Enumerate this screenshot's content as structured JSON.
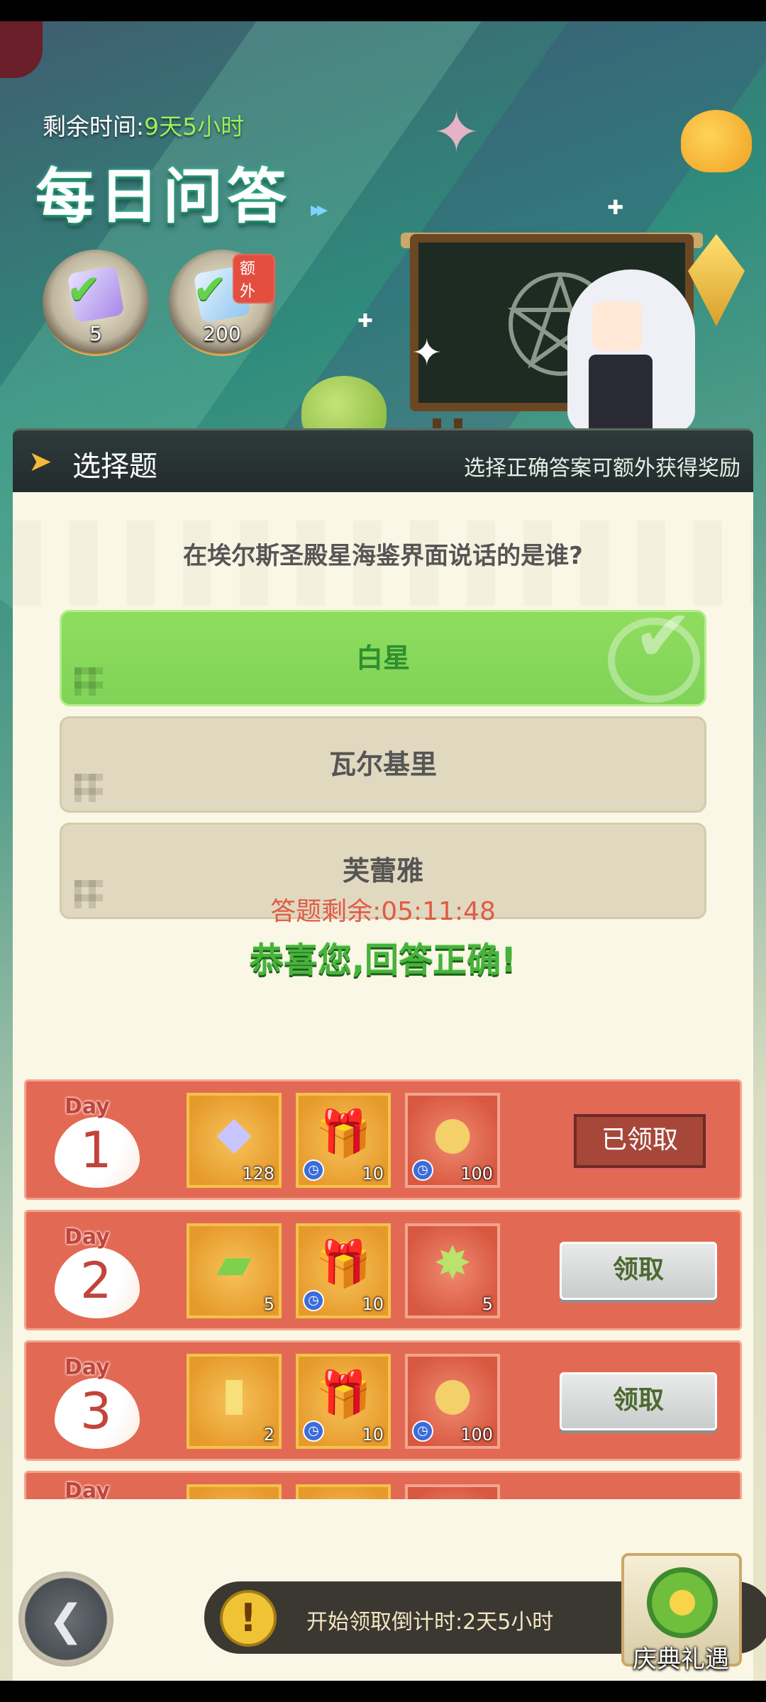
{
  "header": {
    "timer_label": "剩余时间:",
    "timer_value": "9天5小时",
    "title": "每日问答",
    "medals": [
      {
        "icon": "puzzle-check-icon",
        "count": "5"
      },
      {
        "icon": "crystal-check-icon",
        "count": "200",
        "badge": "额外"
      }
    ]
  },
  "panel": {
    "title": "选择题",
    "hint": "选择正确答案可额外获得奖励",
    "question": "在埃尔斯圣殿星海鉴界面说话的是谁?",
    "options": [
      {
        "label": "白星",
        "state": "correct"
      },
      {
        "label": "瓦尔基里",
        "state": "normal"
      },
      {
        "label": "芙蕾雅",
        "state": "normal"
      }
    ],
    "countdown_label": "答题剩余:",
    "countdown_value": "05:11:48",
    "result": "恭喜您,回答正确!"
  },
  "rewards": [
    {
      "day_label": "Day",
      "day": "1",
      "items": [
        {
          "icon": "diamond-icon",
          "qty": "128",
          "timed": false
        },
        {
          "icon": "gift-box-icon",
          "qty": "10",
          "timed": true
        },
        {
          "icon": "red-medal-icon",
          "qty": "100",
          "timed": true
        }
      ],
      "button": "已领取",
      "claimed": true
    },
    {
      "day_label": "Day",
      "day": "2",
      "items": [
        {
          "icon": "ticket-icon",
          "qty": "5",
          "timed": false
        },
        {
          "icon": "gift-box-icon",
          "qty": "10",
          "timed": true
        },
        {
          "icon": "emblem-icon",
          "qty": "5",
          "timed": false
        }
      ],
      "button": "领取",
      "claimed": false
    },
    {
      "day_label": "Day",
      "day": "3",
      "items": [
        {
          "icon": "gold-card-icon",
          "qty": "2",
          "timed": false
        },
        {
          "icon": "gift-box-icon",
          "qty": "10",
          "timed": true
        },
        {
          "icon": "red-medal-icon",
          "qty": "100",
          "timed": true
        }
      ],
      "button": "领取",
      "claimed": false
    },
    {
      "day_label": "Day"
    }
  ],
  "footer": {
    "notice": "开始领取倒计时:2天5小时",
    "gift_label": "庆典礼遇"
  },
  "colors": {
    "accent_green": "#8fdd5f",
    "reward_row": "#e26a55",
    "countdown_red": "#e05a48",
    "timer_green": "#9af05a"
  }
}
